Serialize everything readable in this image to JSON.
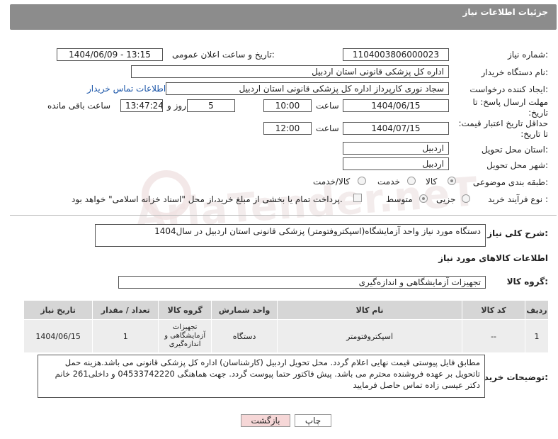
{
  "header": {
    "title": "جزئیات اطلاعات نیاز"
  },
  "fields": {
    "need_number_label": "شماره نیاز:",
    "need_number": "1104003806000023",
    "announce_label": "تاریخ و ساعت اعلان عمومی:",
    "announce_value": "1404/06/09 - 13:15",
    "buyer_org_label": "نام دستگاه خریدار:",
    "buyer_org": "اداره کل پزشکی قانونی استان اردبیل",
    "creator_label": "ایجاد کننده درخواست:",
    "creator": "سجاد نوری کارپرداز اداره کل پزشکی قانونی استان اردبیل",
    "contact_link": "اطلاعات تماس خریدار",
    "deadline_label": "مهلت ارسال پاسخ: تا تاریخ:",
    "deadline_date": "1404/06/15",
    "time_label": "ساعت",
    "deadline_time": "10:00",
    "days_value": "5",
    "days_label": "روز و",
    "remaining_time": "13:47:24",
    "remaining_label": "ساعت باقی مانده",
    "validity_label": "حداقل تاریخ اعتبار قیمت: تا تاریخ:",
    "validity_date": "1404/07/15",
    "validity_time_label": "ساعت",
    "validity_time": "12:00",
    "province_label": "استان محل تحویل:",
    "province": "اردبیل",
    "city_label": "شهر محل تحویل:",
    "city": "اردبیل",
    "category_label": "طبقه بندی موضوعی:",
    "category_options": [
      "کالا",
      "خدمت",
      "کالا/خدمت"
    ],
    "process_label": "نوع فرآیند خرید :",
    "process_options": [
      "جزیی",
      "متوسط"
    ],
    "payment_note": "پرداخت تمام یا بخشی از مبلغ خرید،از محل \"اسناد خزانه اسلامی\" خواهد بود.",
    "description_label": "شرح کلی نیاز:",
    "description": "دستگاه مورد نیاز واحد آزمایشگاه(اسپکتروفتومتر) پزشکی قانونی استان اردبیل در سال1404",
    "goods_info_title": "اطلاعات کالاهای مورد نیاز",
    "goods_group_label": "گروه کالا:",
    "goods_group": "تجهیزات آزمایشگاهی و اندازه‌گیری",
    "buyer_notes_label": "توضیحات خریدار:",
    "buyer_notes": "مطابق فایل پیوستی قیمت نهایی اعلام گردد. محل تحویل اردبیل (کارشناسان) اداره کل پزشکی قانونی می باشد.هزینه حمل تاتحویل بر عهده فروشنده محترم می باشد. پیش فاکتور حتما پیوست گردد. جهت هماهنگی 04533742220 و داخلی261 خانم دکتر عیسی زاده تماس حاصل فرمایید"
  },
  "table": {
    "headers": [
      "ردیف",
      "کد کالا",
      "نام کالا",
      "واحد شمارش",
      "گروه کالا",
      "تعداد / مقدار",
      "تاریخ نیاز"
    ],
    "rows": [
      [
        "1",
        "--",
        "اسپکتروفتومتر",
        "دستگاه",
        "تجهیزات آزمایشگاهی و اندازه‌گیری",
        "1",
        "1404/06/15"
      ]
    ]
  },
  "buttons": {
    "print": "چاپ",
    "back": "بازگشت"
  },
  "watermark": "AriaTender.neT",
  "colors": {
    "header_bg": "#8c8c8c",
    "link": "#1a55a8",
    "back_btn_bg": "#f6d7d7",
    "table_head": "#d6d6d6",
    "table_cell": "#ededed"
  }
}
